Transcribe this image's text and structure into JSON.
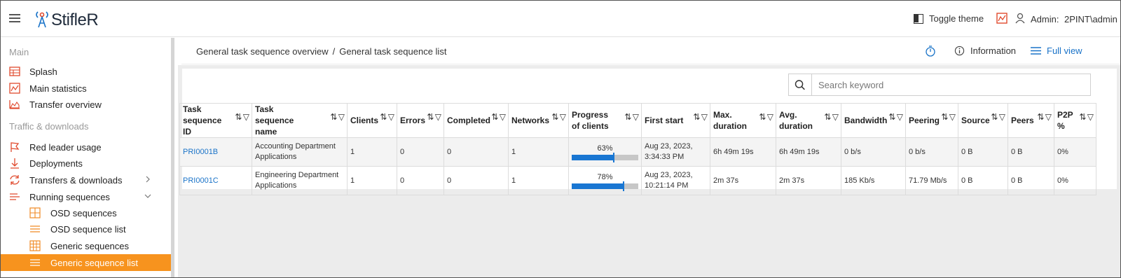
{
  "header": {
    "app_name": "StifleR",
    "toggle_theme": "Toggle theme",
    "admin_label": "Admin:",
    "admin_value": "2PINT\\admin"
  },
  "sidebar": {
    "section_main": "Main",
    "splash": "Splash",
    "main_statistics": "Main statistics",
    "transfer_overview": "Transfer overview",
    "section_traffic": "Traffic & downloads",
    "red_leader_usage": "Red leader usage",
    "deployments": "Deployments",
    "transfers_downloads": "Transfers & downloads",
    "running_sequences": "Running sequences",
    "osd_sequences": "OSD sequences",
    "osd_sequence_list": "OSD sequence list",
    "generic_sequences": "Generic sequences",
    "generic_sequence_list": "Generic sequence list"
  },
  "breadcrumb": {
    "parent": "General task sequence overview",
    "separator": "/",
    "current": "General task sequence list"
  },
  "toolbar": {
    "information": "Information",
    "full_view": "Full view"
  },
  "search": {
    "placeholder": "Search keyword"
  },
  "table": {
    "columns": [
      "Task sequence ID",
      "Task sequence name",
      "Clients",
      "Errors",
      "Completed",
      "Networks",
      "Progress of clients",
      "First start",
      "Max. duration",
      "Avg. duration",
      "Bandwidth",
      "Peering",
      "Source",
      "Peers",
      "P2P %"
    ],
    "rows": [
      {
        "id": "PRI0001B",
        "name": "Accounting Department Applications",
        "clients": "1",
        "errors": "0",
        "completed": "0",
        "networks": "1",
        "progress_label": "63%",
        "progress": 0.63,
        "first_start": "Aug 23, 2023, 3:34:33 PM",
        "max_duration": "6h 49m 19s",
        "avg_duration": "6h 49m 19s",
        "bandwidth": "0 b/s",
        "peering": "0 b/s",
        "source": "0 B",
        "peers": "0 B",
        "p2p": "0%"
      },
      {
        "id": "PRI0001C",
        "name": "Engineering Department Applications",
        "clients": "1",
        "errors": "0",
        "completed": "0",
        "networks": "1",
        "progress_label": "78%",
        "progress": 0.78,
        "first_start": "Aug 23, 2023, 10:21:14 PM",
        "max_duration": "2m 37s",
        "avg_duration": "2m 37s",
        "bandwidth": "185 Kb/s",
        "peering": "71.79 Mb/s",
        "source": "0 B",
        "peers": "0 B",
        "p2p": "0%"
      }
    ]
  },
  "colors": {
    "accent_orange": "#f7931e",
    "icon_red": "#e04a2e",
    "link_blue": "#1a73c8",
    "progress_blue": "#1976d2"
  }
}
